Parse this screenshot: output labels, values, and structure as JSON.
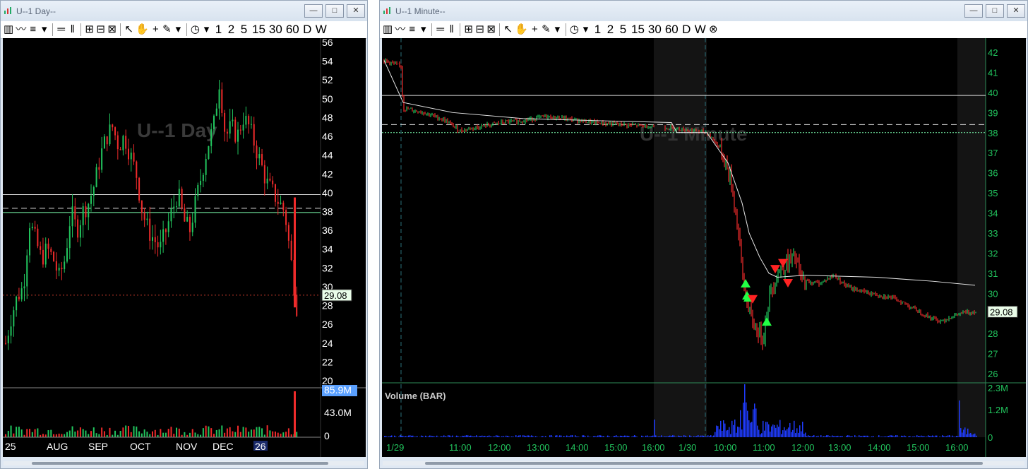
{
  "windows": {
    "day": {
      "title": "U--1 Day--",
      "watermark": "U--1 Day",
      "toolbar": [
        "1",
        "2",
        "5",
        "15",
        "30",
        "60",
        "D",
        "W"
      ],
      "price_ticks": [
        "56",
        "54",
        "52",
        "50",
        "48",
        "46",
        "44",
        "42",
        "40",
        "38",
        "36",
        "34",
        "32",
        "30",
        "28",
        "26",
        "24",
        "22",
        "20"
      ],
      "last_price": "29.08",
      "volume_ticks": [
        "85.9M",
        "43.0M",
        "0"
      ],
      "time_labels": [
        "25",
        "AUG",
        "SEP",
        "OCT",
        "NOV",
        "DEC",
        "26"
      ]
    },
    "minute": {
      "title": "U--1 Minute--",
      "watermark": "U--1 Minute",
      "toolbar": [
        "1",
        "2",
        "5",
        "15",
        "30",
        "60",
        "D",
        "W"
      ],
      "price_ticks": [
        "42",
        "41",
        "40",
        "39",
        "38",
        "37",
        "36",
        "35",
        "34",
        "33",
        "32",
        "31",
        "30",
        "29",
        "28",
        "27",
        "26"
      ],
      "last_price": "29.08",
      "volume_title": "Volume (BAR)",
      "volume_ticks": [
        "2.3M",
        "1.2M",
        "0"
      ],
      "time_labels": [
        "1/29",
        "11:00",
        "12:00",
        "13:00",
        "14:00",
        "15:00",
        "16:00",
        "1/30",
        "10:00",
        "11:00",
        "12:00",
        "13:00",
        "14:00",
        "15:00",
        "16:00"
      ]
    }
  },
  "colors": {
    "up": "#22c55e",
    "down": "#ef2b2b",
    "chart_bg": "#000000",
    "axis_text": "#22c55e",
    "volume": "#1f3cff",
    "vwap": "#e6e6e6"
  },
  "window_buttons": {
    "minimize": "—",
    "maximize": "□",
    "close": "✕"
  },
  "icons": [
    "app-icon",
    "bar-chart-icon",
    "line-chart-icon",
    "drawing-icon",
    "dropdown-arrow-icon",
    "hline-icon",
    "vline-icon",
    "zoom-in-icon",
    "zoom-out-icon",
    "zoom-fit-icon",
    "pointer-icon",
    "hand-icon",
    "crosshair-icon",
    "pencil-icon",
    "clock-icon",
    "close-circle-icon"
  ]
}
